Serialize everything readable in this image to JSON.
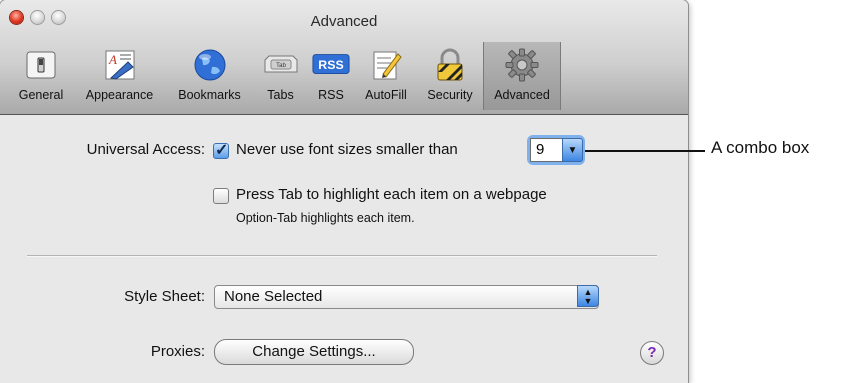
{
  "window": {
    "title": "Advanced"
  },
  "toolbar": {
    "items": [
      {
        "label": "General",
        "icon": "general-switch-icon"
      },
      {
        "label": "Appearance",
        "icon": "appearance-icon"
      },
      {
        "label": "Bookmarks",
        "icon": "globe-icon"
      },
      {
        "label": "Tabs",
        "icon": "tabs-icon"
      },
      {
        "label": "RSS",
        "icon": "rss-icon"
      },
      {
        "label": "AutoFill",
        "icon": "autofill-pencil-icon"
      },
      {
        "label": "Security",
        "icon": "lock-icon"
      },
      {
        "label": "Advanced",
        "icon": "gear-icon"
      }
    ],
    "selected": "Advanced",
    "tabs_icon_text": "Tab",
    "rss_icon_text": "RSS"
  },
  "universal_access": {
    "label": "Universal Access:",
    "font_option": {
      "label": "Never use font sizes smaller than",
      "checked": true
    },
    "font_size": "9",
    "tab_option": {
      "label": "Press Tab to highlight each item on a webpage",
      "checked": false
    },
    "tab_hint": "Option-Tab highlights each item."
  },
  "style_sheet": {
    "label": "Style Sheet:",
    "value": "None Selected"
  },
  "proxies": {
    "label": "Proxies:",
    "button": "Change Settings..."
  },
  "help": {
    "symbol": "?"
  },
  "callout": {
    "text": "A combo box"
  },
  "colors": {
    "accent": "#3d86e3",
    "focus_ring": "#7fb1ec",
    "help": "#7a28b4"
  }
}
